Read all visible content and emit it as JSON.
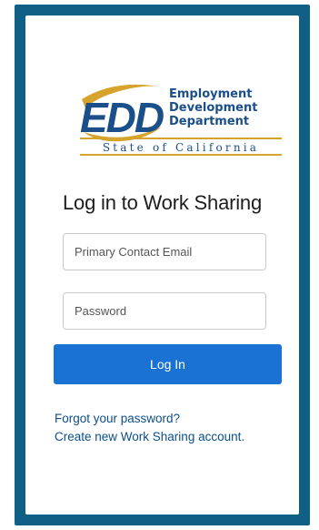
{
  "logo": {
    "abbrev": "EDD",
    "line1": "Employment",
    "line2": "Development",
    "line3": "Department",
    "state": "State of California",
    "colors": {
      "blue": "#1b4f8a",
      "gold": "#d6a32c"
    }
  },
  "login": {
    "title": "Log in to Work Sharing",
    "email_placeholder": "Primary Contact Email",
    "password_placeholder": "Password",
    "submit_label": "Log In",
    "forgot_link": "Forgot your password?",
    "create_link": "Create new Work Sharing account."
  },
  "colors": {
    "frame": "#0f5f86",
    "button": "#1a73d4",
    "link": "#0b4f8a"
  }
}
